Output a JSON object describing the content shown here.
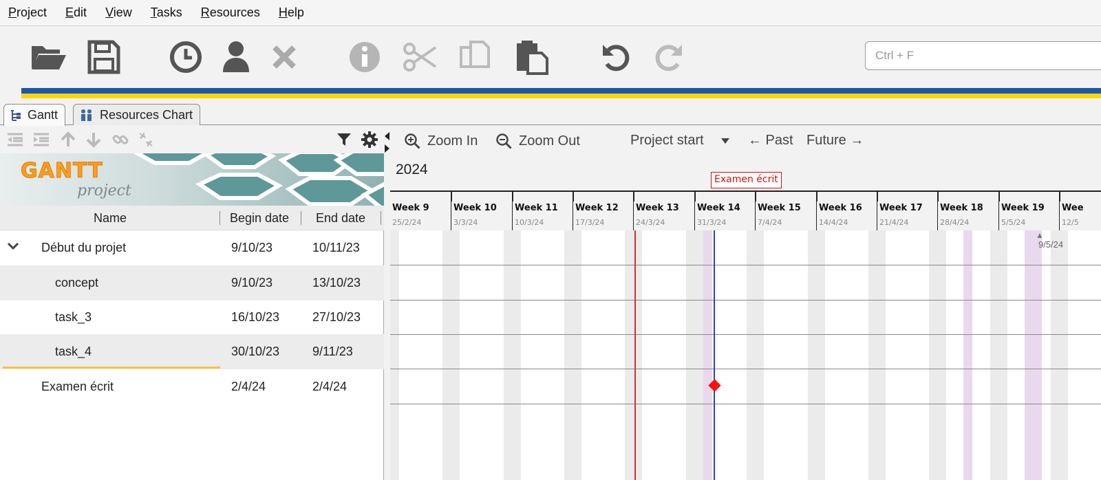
{
  "menu": [
    "Project",
    "Edit",
    "View",
    "Tasks",
    "Resources",
    "Help"
  ],
  "toolbar": {
    "buttons": [
      "open-folder-icon",
      "save-icon",
      "clock-icon",
      "user-icon",
      "delete-icon",
      "info-icon",
      "cut-icon",
      "copy-icon",
      "paste-icon",
      "undo-icon",
      "redo-icon"
    ],
    "search_placeholder": "Ctrl + F"
  },
  "tabs": [
    {
      "label": "Gantt",
      "active": true
    },
    {
      "label": "Resources Chart",
      "active": false
    }
  ],
  "logo": {
    "big": "GANTT",
    "small": "project"
  },
  "columns": {
    "name": "Name",
    "begin": "Begin date",
    "end": "End date"
  },
  "tasks": [
    {
      "name": "Début du projet",
      "begin": "9/10/23",
      "end": "10/11/23"
    },
    {
      "name": "concept",
      "begin": "9/10/23",
      "end": "13/10/23"
    },
    {
      "name": "task_3",
      "begin": "16/10/23",
      "end": "27/10/23"
    },
    {
      "name": "task_4",
      "begin": "30/10/23",
      "end": "9/11/23"
    },
    {
      "name": "Examen écrit",
      "begin": "2/4/24",
      "end": "2/4/24"
    }
  ],
  "chart_toolbar": {
    "zoom_in": "Zoom In",
    "zoom_out": "Zoom Out",
    "project_start": "Project start",
    "past": "← Past",
    "future": "Future →"
  },
  "timeline": {
    "year": "2024",
    "weeks": [
      {
        "label": "Week 9",
        "date": "25/2/24"
      },
      {
        "label": "Week 10",
        "date": "3/3/24"
      },
      {
        "label": "Week 11",
        "date": "10/3/24"
      },
      {
        "label": "Week 12",
        "date": "17/3/24"
      },
      {
        "label": "Week 13",
        "date": "24/3/24"
      },
      {
        "label": "Week 14",
        "date": "31/3/24"
      },
      {
        "label": "Week 15",
        "date": "7/4/24"
      },
      {
        "label": "Week 16",
        "date": "14/4/24"
      },
      {
        "label": "Week 17",
        "date": "21/4/24"
      },
      {
        "label": "Week 18",
        "date": "28/4/24"
      },
      {
        "label": "Week 19",
        "date": "5/5/24"
      },
      {
        "label": "Wee",
        "date": "12/5"
      }
    ],
    "milestone_label": "Examen écrit",
    "offscreen_date": "9/5/24"
  },
  "colors": {
    "stripe_blue": "#1a55b0",
    "stripe_yellow": "#ffd500",
    "milestone": "#ff1010",
    "today_line": "#c0392b",
    "milestone_line": "#2a3fd0"
  }
}
